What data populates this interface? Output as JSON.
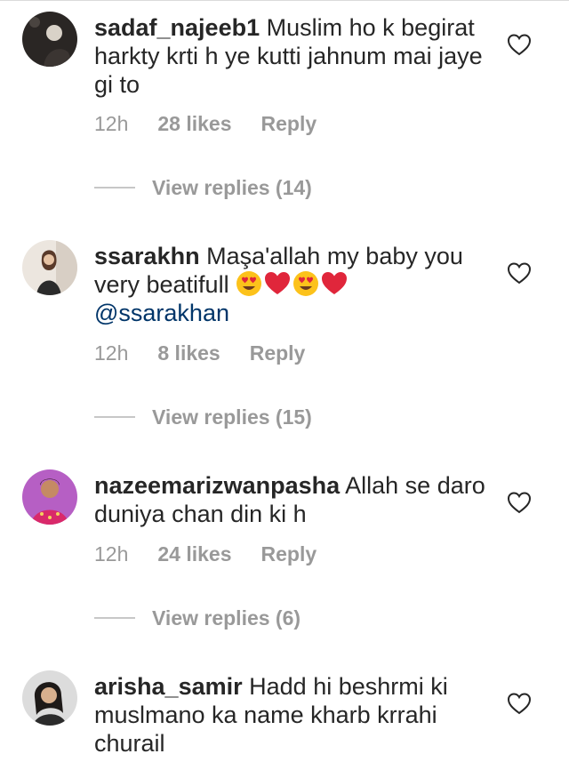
{
  "comments": [
    {
      "username": "sadaf_najeeb1",
      "text": "Muslim ho k begirat harkty krti h ye kutti jahnum mai jaye gi to",
      "time": "12h",
      "likes": "28 likes",
      "reply": "Reply",
      "view_replies": "View replies (14)"
    },
    {
      "username": "ssarakhn",
      "text": "Maşa'allah my baby you very beatifull",
      "emojis": [
        "heart-eyes",
        "red-heart",
        "heart-eyes",
        "red-heart"
      ],
      "mention": "@ssarakhan",
      "time": "12h",
      "likes": "8 likes",
      "reply": "Reply",
      "view_replies": "View replies (15)"
    },
    {
      "username": "nazeemarizwanpasha",
      "text": "Allah se daro duniya chan din ki h",
      "time": "12h",
      "likes": "24 likes",
      "reply": "Reply",
      "view_replies": "View replies (6)"
    },
    {
      "username": "arisha_samir",
      "text": "Hadd hi beshrmi ki muslmano ka name kharb krrahi churail"
    }
  ],
  "icons": {
    "like": "heart-outline-icon"
  },
  "colors": {
    "text": "#262626",
    "muted": "#999999",
    "mention": "#003569",
    "divider": "#c7c7c7"
  }
}
